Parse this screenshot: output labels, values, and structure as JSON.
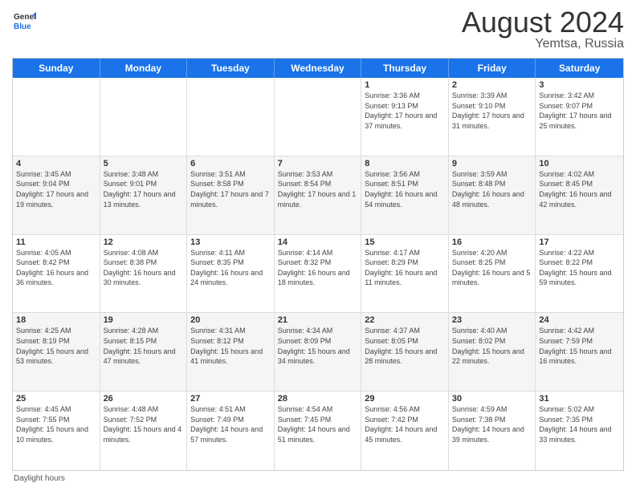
{
  "logo": {
    "line1": "General",
    "line2": "Blue"
  },
  "title": "August 2024",
  "subtitle": "Yemtsa, Russia",
  "days_of_week": [
    "Sunday",
    "Monday",
    "Tuesday",
    "Wednesday",
    "Thursday",
    "Friday",
    "Saturday"
  ],
  "footer_text": "Daylight hours",
  "weeks": [
    [
      {
        "day": "",
        "sunrise": "",
        "sunset": "",
        "daylight": ""
      },
      {
        "day": "",
        "sunrise": "",
        "sunset": "",
        "daylight": ""
      },
      {
        "day": "",
        "sunrise": "",
        "sunset": "",
        "daylight": ""
      },
      {
        "day": "",
        "sunrise": "",
        "sunset": "",
        "daylight": ""
      },
      {
        "day": "1",
        "sunrise": "Sunrise: 3:36 AM",
        "sunset": "Sunset: 9:13 PM",
        "daylight": "Daylight: 17 hours and 37 minutes."
      },
      {
        "day": "2",
        "sunrise": "Sunrise: 3:39 AM",
        "sunset": "Sunset: 9:10 PM",
        "daylight": "Daylight: 17 hours and 31 minutes."
      },
      {
        "day": "3",
        "sunrise": "Sunrise: 3:42 AM",
        "sunset": "Sunset: 9:07 PM",
        "daylight": "Daylight: 17 hours and 25 minutes."
      }
    ],
    [
      {
        "day": "4",
        "sunrise": "Sunrise: 3:45 AM",
        "sunset": "Sunset: 9:04 PM",
        "daylight": "Daylight: 17 hours and 19 minutes."
      },
      {
        "day": "5",
        "sunrise": "Sunrise: 3:48 AM",
        "sunset": "Sunset: 9:01 PM",
        "daylight": "Daylight: 17 hours and 13 minutes."
      },
      {
        "day": "6",
        "sunrise": "Sunrise: 3:51 AM",
        "sunset": "Sunset: 8:58 PM",
        "daylight": "Daylight: 17 hours and 7 minutes."
      },
      {
        "day": "7",
        "sunrise": "Sunrise: 3:53 AM",
        "sunset": "Sunset: 8:54 PM",
        "daylight": "Daylight: 17 hours and 1 minute."
      },
      {
        "day": "8",
        "sunrise": "Sunrise: 3:56 AM",
        "sunset": "Sunset: 8:51 PM",
        "daylight": "Daylight: 16 hours and 54 minutes."
      },
      {
        "day": "9",
        "sunrise": "Sunrise: 3:59 AM",
        "sunset": "Sunset: 8:48 PM",
        "daylight": "Daylight: 16 hours and 48 minutes."
      },
      {
        "day": "10",
        "sunrise": "Sunrise: 4:02 AM",
        "sunset": "Sunset: 8:45 PM",
        "daylight": "Daylight: 16 hours and 42 minutes."
      }
    ],
    [
      {
        "day": "11",
        "sunrise": "Sunrise: 4:05 AM",
        "sunset": "Sunset: 8:42 PM",
        "daylight": "Daylight: 16 hours and 36 minutes."
      },
      {
        "day": "12",
        "sunrise": "Sunrise: 4:08 AM",
        "sunset": "Sunset: 8:38 PM",
        "daylight": "Daylight: 16 hours and 30 minutes."
      },
      {
        "day": "13",
        "sunrise": "Sunrise: 4:11 AM",
        "sunset": "Sunset: 8:35 PM",
        "daylight": "Daylight: 16 hours and 24 minutes."
      },
      {
        "day": "14",
        "sunrise": "Sunrise: 4:14 AM",
        "sunset": "Sunset: 8:32 PM",
        "daylight": "Daylight: 16 hours and 18 minutes."
      },
      {
        "day": "15",
        "sunrise": "Sunrise: 4:17 AM",
        "sunset": "Sunset: 8:29 PM",
        "daylight": "Daylight: 16 hours and 11 minutes."
      },
      {
        "day": "16",
        "sunrise": "Sunrise: 4:20 AM",
        "sunset": "Sunset: 8:25 PM",
        "daylight": "Daylight: 16 hours and 5 minutes."
      },
      {
        "day": "17",
        "sunrise": "Sunrise: 4:22 AM",
        "sunset": "Sunset: 8:22 PM",
        "daylight": "Daylight: 15 hours and 59 minutes."
      }
    ],
    [
      {
        "day": "18",
        "sunrise": "Sunrise: 4:25 AM",
        "sunset": "Sunset: 8:19 PM",
        "daylight": "Daylight: 15 hours and 53 minutes."
      },
      {
        "day": "19",
        "sunrise": "Sunrise: 4:28 AM",
        "sunset": "Sunset: 8:15 PM",
        "daylight": "Daylight: 15 hours and 47 minutes."
      },
      {
        "day": "20",
        "sunrise": "Sunrise: 4:31 AM",
        "sunset": "Sunset: 8:12 PM",
        "daylight": "Daylight: 15 hours and 41 minutes."
      },
      {
        "day": "21",
        "sunrise": "Sunrise: 4:34 AM",
        "sunset": "Sunset: 8:09 PM",
        "daylight": "Daylight: 15 hours and 34 minutes."
      },
      {
        "day": "22",
        "sunrise": "Sunrise: 4:37 AM",
        "sunset": "Sunset: 8:05 PM",
        "daylight": "Daylight: 15 hours and 28 minutes."
      },
      {
        "day": "23",
        "sunrise": "Sunrise: 4:40 AM",
        "sunset": "Sunset: 8:02 PM",
        "daylight": "Daylight: 15 hours and 22 minutes."
      },
      {
        "day": "24",
        "sunrise": "Sunrise: 4:42 AM",
        "sunset": "Sunset: 7:59 PM",
        "daylight": "Daylight: 15 hours and 16 minutes."
      }
    ],
    [
      {
        "day": "25",
        "sunrise": "Sunrise: 4:45 AM",
        "sunset": "Sunset: 7:55 PM",
        "daylight": "Daylight: 15 hours and 10 minutes."
      },
      {
        "day": "26",
        "sunrise": "Sunrise: 4:48 AM",
        "sunset": "Sunset: 7:52 PM",
        "daylight": "Daylight: 15 hours and 4 minutes."
      },
      {
        "day": "27",
        "sunrise": "Sunrise: 4:51 AM",
        "sunset": "Sunset: 7:49 PM",
        "daylight": "Daylight: 14 hours and 57 minutes."
      },
      {
        "day": "28",
        "sunrise": "Sunrise: 4:54 AM",
        "sunset": "Sunset: 7:45 PM",
        "daylight": "Daylight: 14 hours and 51 minutes."
      },
      {
        "day": "29",
        "sunrise": "Sunrise: 4:56 AM",
        "sunset": "Sunset: 7:42 PM",
        "daylight": "Daylight: 14 hours and 45 minutes."
      },
      {
        "day": "30",
        "sunrise": "Sunrise: 4:59 AM",
        "sunset": "Sunset: 7:38 PM",
        "daylight": "Daylight: 14 hours and 39 minutes."
      },
      {
        "day": "31",
        "sunrise": "Sunrise: 5:02 AM",
        "sunset": "Sunset: 7:35 PM",
        "daylight": "Daylight: 14 hours and 33 minutes."
      }
    ]
  ]
}
